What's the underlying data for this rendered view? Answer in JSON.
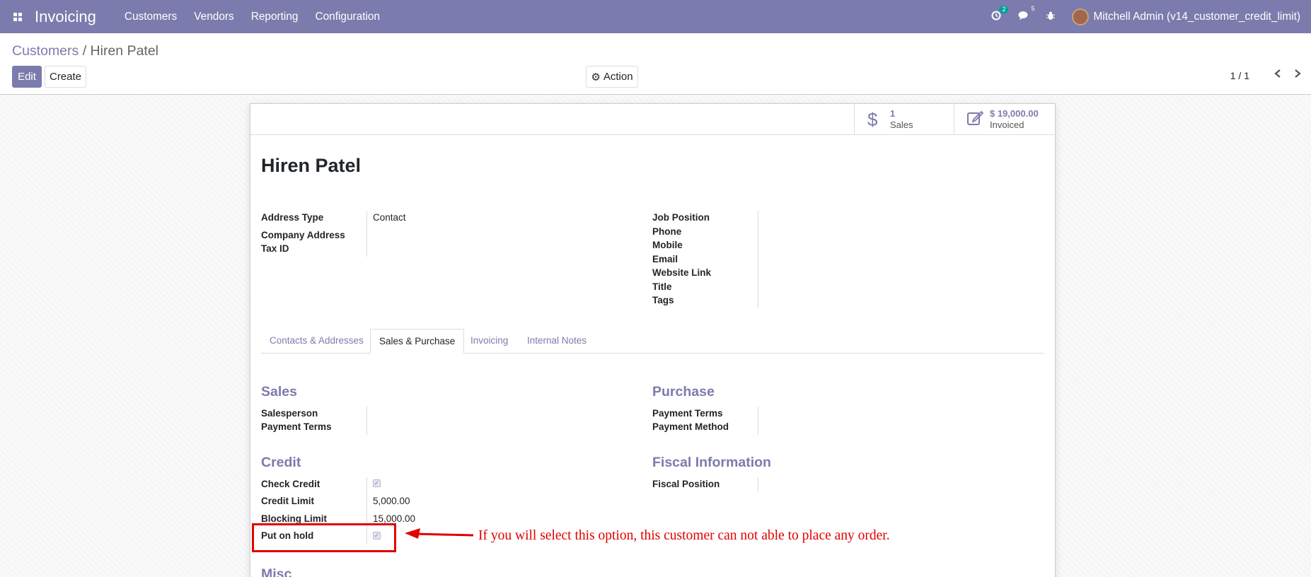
{
  "app": {
    "name": "Invoicing"
  },
  "menu": [
    "Customers",
    "Vendors",
    "Reporting",
    "Configuration"
  ],
  "systray": {
    "activity_count": "2",
    "messages_count": "5",
    "user": "Mitchell Admin (v14_customer_credit_limit)"
  },
  "breadcrumb": {
    "parent": "Customers",
    "separator": "/",
    "current": "Hiren Patel"
  },
  "buttons": {
    "edit": "Edit",
    "create": "Create",
    "action": "Action"
  },
  "pager": {
    "text": "1 / 1"
  },
  "smart_buttons": {
    "sales": {
      "value": "1",
      "label": "Sales"
    },
    "invoiced": {
      "value": "$ 19,000.00",
      "label": "Invoiced"
    }
  },
  "partner": {
    "name": "Hiren Patel"
  },
  "left_fields": {
    "address_type_label": "Address Type",
    "address_type_value": "Contact",
    "company_address_label": "Company Address",
    "tax_id_label": "Tax ID"
  },
  "right_fields": [
    "Job Position",
    "Phone",
    "Mobile",
    "Email",
    "Website Link",
    "Title",
    "Tags"
  ],
  "tabs": [
    "Contacts & Addresses",
    "Sales & Purchase",
    "Invoicing",
    "Internal Notes"
  ],
  "sales": {
    "title": "Sales",
    "salesperson": "Salesperson",
    "payment_terms": "Payment Terms"
  },
  "purchase": {
    "title": "Purchase",
    "payment_terms": "Payment Terms",
    "payment_method": "Payment Method"
  },
  "credit": {
    "title": "Credit",
    "check_credit_label": "Check Credit",
    "credit_limit_label": "Credit Limit",
    "credit_limit_value": "5,000.00",
    "blocking_limit_label": "Blocking Limit",
    "blocking_limit_value": "15,000.00",
    "put_on_hold_label": "Put on hold"
  },
  "fiscal": {
    "title": "Fiscal Information",
    "fiscal_position": "Fiscal Position"
  },
  "misc": {
    "title": "Misc"
  },
  "annotation": {
    "text": "If you will select this option, this customer can not able to place any order.",
    "color": "#e00000"
  },
  "colors": {
    "brand": "#7c7bad"
  }
}
